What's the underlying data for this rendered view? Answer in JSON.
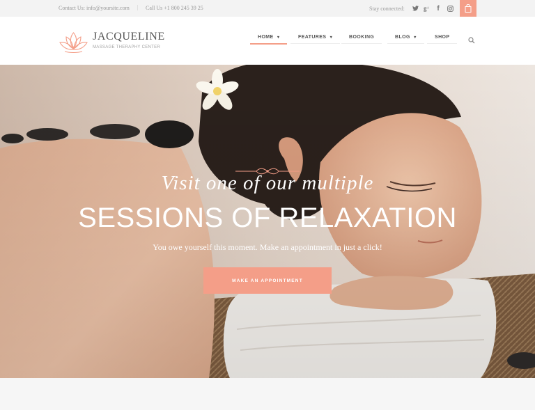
{
  "topbar": {
    "contact": "Contact Us: info@yoursite.com",
    "separator": "|",
    "phone": "Call Us +1 800 245 39 25",
    "stay_connected": "Stay connected:",
    "social": {
      "twitter": "twitter-icon",
      "google": "google-plus-icon",
      "facebook": "facebook-icon",
      "instagram": "instagram-icon"
    },
    "cart_icon": "shopping-bag-icon"
  },
  "brand": {
    "title": "JACQUELINE",
    "subtitle": "MASSAGE THERAPHY CENTER",
    "logo_icon": "lotus-icon"
  },
  "nav": {
    "home": "HOME",
    "features": "FEATURES",
    "booking": "BOOKING",
    "blog": "BLOG",
    "shop": "SHOP",
    "active": "HOME",
    "search_icon": "search-icon"
  },
  "hero": {
    "script": "Visit one of our multiple",
    "headline": "SESSIONS OF RELAXATION",
    "subline": "You owe yourself this moment. Make an appointment in just a click!",
    "cta": "MAKE AN APPOINTMENT"
  },
  "colors": {
    "accent": "#f49e88",
    "text": "#555555",
    "muted": "#9a9a9a",
    "topbar_bg": "#f3f3f3"
  }
}
